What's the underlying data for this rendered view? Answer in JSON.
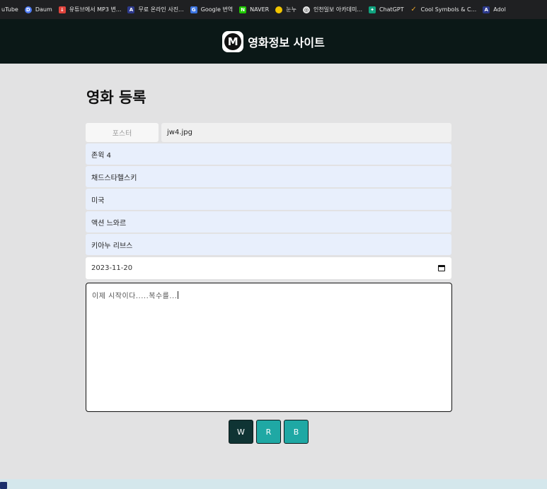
{
  "bookmarks": [
    {
      "label": "uTube",
      "icon": "youtube-icon",
      "color": "#1f2022"
    },
    {
      "label": "Daum",
      "icon": "daum-icon",
      "color": "#4f7cf5"
    },
    {
      "label": "유튜브에서 MP3 변...",
      "icon": "download-icon",
      "color": "#e0443d"
    },
    {
      "label": "무료 온라인 사진...",
      "icon": "adobe-icon",
      "color": "#2d3a8c"
    },
    {
      "label": "Google 번역",
      "icon": "translate-icon",
      "color": "#3b74e0"
    },
    {
      "label": "NAVER",
      "icon": "naver-icon",
      "color": "#1ec800"
    },
    {
      "label": "눈누",
      "icon": "noonnu-icon",
      "color": "#f2c500"
    },
    {
      "label": "인천일보 아카데미...",
      "icon": "globe-icon",
      "color": "#e8e8e8"
    },
    {
      "label": "ChatGPT",
      "icon": "chatgpt-icon",
      "color": "#10a37f"
    },
    {
      "label": "Cool Symbols & C...",
      "icon": "check-icon",
      "color": "#e8a32a"
    },
    {
      "label": "Adol",
      "icon": "adobe-icon",
      "color": "#2d3a8c"
    }
  ],
  "header": {
    "logo_letter": "M",
    "site_title": "영화정보 사이트"
  },
  "form": {
    "title": "영화 등록",
    "poster_label": "포스터",
    "poster_file": "jw4.jpg",
    "fields": [
      "존윅 4",
      "채드스타헬스키",
      "미국",
      "액션 느와르",
      "키아누 리브스"
    ],
    "date": "2023-11-20",
    "description": "이제 시작이다.....복수를...",
    "buttons": [
      {
        "label": "W",
        "color": "#0f3434"
      },
      {
        "label": "R",
        "color": "#1fa8a4"
      },
      {
        "label": "B",
        "color": "#1fa8a4"
      }
    ]
  }
}
